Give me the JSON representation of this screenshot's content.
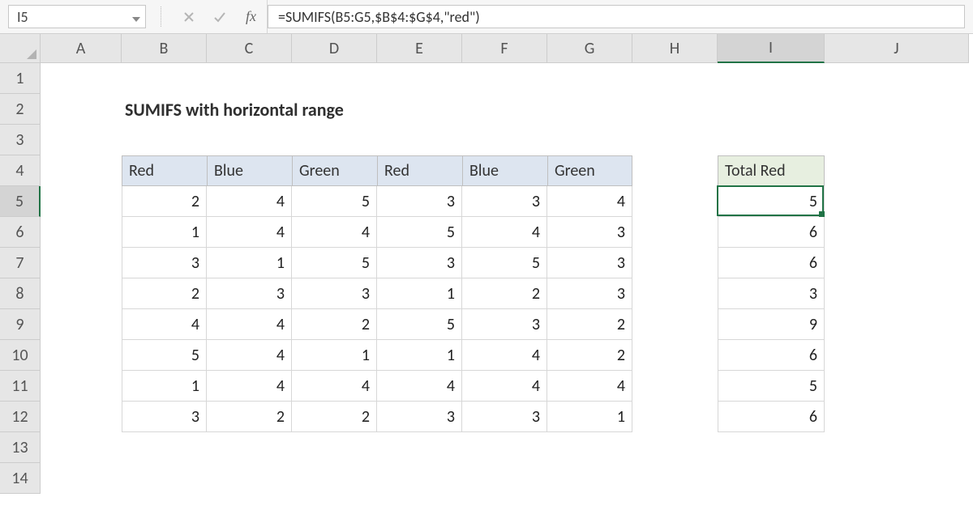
{
  "name_box": "I5",
  "formula": "=SUMIFS(B5:G5,$B$4:$G$4,\"red\")",
  "fx_label": "fx",
  "columns": [
    "A",
    "B",
    "C",
    "D",
    "E",
    "F",
    "G",
    "H",
    "I",
    "J"
  ],
  "rows": [
    "1",
    "2",
    "3",
    "4",
    "5",
    "6",
    "7",
    "8",
    "9",
    "10",
    "11",
    "12",
    "13",
    "14"
  ],
  "selected_col": "I",
  "selected_row": "5",
  "title": "SUMIFS with horizontal range",
  "headers_bg": [
    "Red",
    "Blue",
    "Green",
    "Red",
    "Blue",
    "Green"
  ],
  "header_i": "Total Red",
  "data": [
    [
      2,
      4,
      5,
      3,
      3,
      4
    ],
    [
      1,
      4,
      4,
      5,
      4,
      3
    ],
    [
      3,
      1,
      5,
      3,
      5,
      3
    ],
    [
      2,
      3,
      3,
      1,
      2,
      3
    ],
    [
      4,
      4,
      2,
      5,
      3,
      2
    ],
    [
      5,
      4,
      1,
      1,
      4,
      2
    ],
    [
      1,
      4,
      4,
      4,
      4,
      4
    ],
    [
      3,
      2,
      2,
      3,
      3,
      1
    ]
  ],
  "totals": [
    5,
    6,
    6,
    3,
    9,
    6,
    5,
    6
  ],
  "active_cell_value": "5",
  "chart_data": {
    "type": "table",
    "title": "SUMIFS with horizontal range",
    "columns": [
      "Red",
      "Blue",
      "Green",
      "Red",
      "Blue",
      "Green",
      "Total Red"
    ],
    "rows": [
      [
        2,
        4,
        5,
        3,
        3,
        4,
        5
      ],
      [
        1,
        4,
        4,
        5,
        4,
        3,
        6
      ],
      [
        3,
        1,
        5,
        3,
        5,
        3,
        6
      ],
      [
        2,
        3,
        3,
        1,
        2,
        3,
        3
      ],
      [
        4,
        4,
        2,
        5,
        3,
        2,
        9
      ],
      [
        5,
        4,
        1,
        1,
        4,
        2,
        6
      ],
      [
        1,
        4,
        4,
        4,
        4,
        4,
        5
      ],
      [
        3,
        2,
        2,
        3,
        3,
        1,
        6
      ]
    ]
  }
}
